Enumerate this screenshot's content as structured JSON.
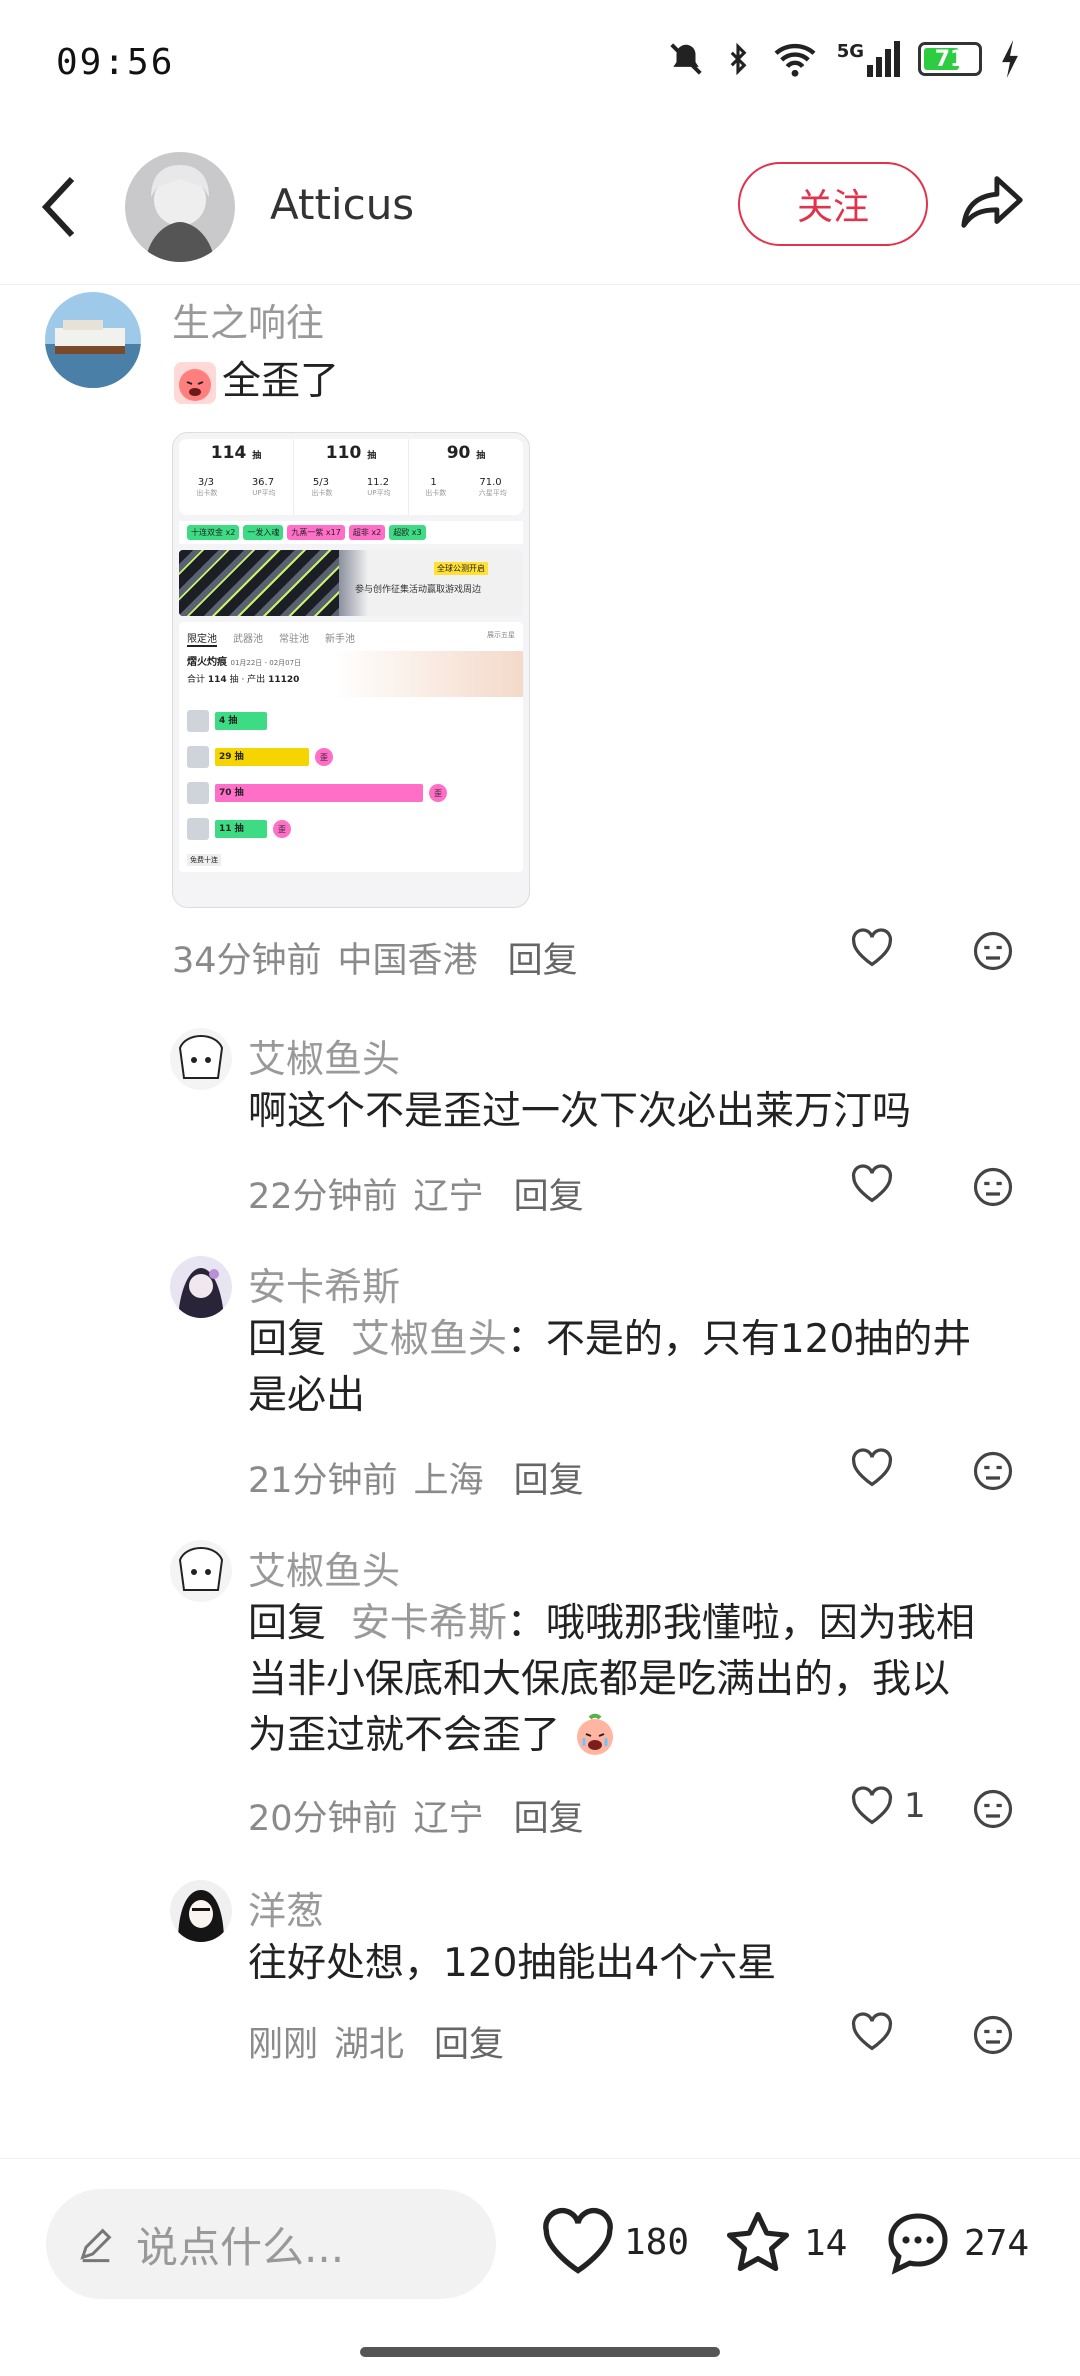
{
  "status_bar": {
    "time": "09:56",
    "network": "5G",
    "battery": "71"
  },
  "header": {
    "title": "Atticus",
    "follow_label": "关注"
  },
  "comments": [
    {
      "author": "生之响往",
      "text": "全歪了",
      "time": "34分钟前",
      "location": "中国香港",
      "reply_label": "回复",
      "likes": ""
    },
    {
      "author": "艾椒鱼头",
      "text": "啊这个不是歪过一次下次必出莱万汀吗",
      "time": "22分钟前",
      "location": "辽宁",
      "reply_label": "回复",
      "likes": ""
    },
    {
      "author": "安卡希斯",
      "reply_prefix": "回复",
      "reply_to": "艾椒鱼头",
      "text_line1": "：不是的，只有120抽的井",
      "text_line2": "是必出",
      "time": "21分钟前",
      "location": "上海",
      "reply_label": "回复",
      "likes": ""
    },
    {
      "author": "艾椒鱼头",
      "reply_prefix": "回复",
      "reply_to": "安卡希斯",
      "text_line1": "：哦哦那我懂啦，因为我相",
      "text_line2": "当非小保底和大保底都是吃满出的，我以",
      "text_line3": "为歪过就不会歪了",
      "time": "20分钟前",
      "location": "辽宁",
      "reply_label": "回复",
      "likes": "1"
    },
    {
      "author": "洋葱",
      "text": "往好处想，120抽能出4个六星",
      "time": "刚刚",
      "location": "湖北",
      "reply_label": "回复",
      "likes": ""
    }
  ],
  "screenshot_card": {
    "stats": [
      {
        "value": "114",
        "unit": "抽",
        "a": "3/3",
        "b": "36.7",
        "la": "出卡数",
        "lb": "UP平均"
      },
      {
        "value": "110",
        "unit": "抽",
        "a": "5/3",
        "b": "11.2",
        "la": "出卡数",
        "lb": "UP平均"
      },
      {
        "value": "90",
        "unit": "抽",
        "a": "1",
        "b": "71.0",
        "la": "出卡数",
        "lb": "六星平均"
      }
    ],
    "tags": [
      "十连双金 x2",
      "一发入魂",
      "九蒸一紫 x17",
      "超非 x2",
      "超欧 x3"
    ],
    "banner_text": "参与创作征集活动赢取游戏周边",
    "banner_badge": "全球公测开启",
    "tabs": [
      "限定池",
      "武器池",
      "常驻池",
      "新手池"
    ],
    "toggle_label": "展示五星",
    "pool_name": "熠火灼痕",
    "pool_dates": "01月22日 - 02月07日",
    "total_label": "合计",
    "total_value": "114",
    "total_unit": "抽",
    "output_label": "产出",
    "output_value": "11120",
    "bars": [
      {
        "label": "4 抽",
        "color": "#3ddc84",
        "pct": 0.2,
        "tag": ""
      },
      {
        "label": "29 抽",
        "color": "#f5d400",
        "pct": 0.36,
        "tag": "歪"
      },
      {
        "label": "70 抽",
        "color": "#ff6ec7",
        "pct": 0.8,
        "tag": "歪"
      },
      {
        "label": "11 抽",
        "color": "#3ddc84",
        "pct": 0.2,
        "tag": "歪"
      }
    ],
    "free_label": "免费十连"
  },
  "bottom_bar": {
    "input_placeholder": "说点什么...",
    "likes": "180",
    "stars": "14",
    "comments": "274"
  },
  "colors": {
    "accent": "#e0344d",
    "meta": "#8a8a8a",
    "author": "#999999"
  }
}
